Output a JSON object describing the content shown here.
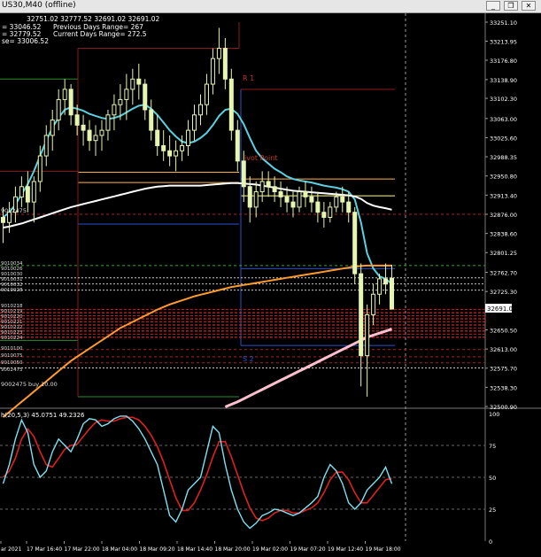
{
  "window": {
    "title": "US30,M40 (offline)",
    "minimize_label": "_",
    "restore_label": "❐",
    "close_label": "✕"
  },
  "info": {
    "ohlc_line": "32751.02 32777.52 32691.02 32691.02",
    "line2": "= 33046.52",
    "line3": "= 32779.52",
    "line4": "se= 33006.52",
    "prev_range": "Previous Days Range= 267",
    "curr_range": "Current Days Range= 272.5"
  },
  "price_axis": {
    "ticks": [
      "33251.10",
      "33213.95",
      "33176.80",
      "33138.90",
      "33102.30",
      "33063.00",
      "33025.60",
      "32988.35",
      "32950.80",
      "32913.40",
      "32876.00",
      "32838.60",
      "32801.25",
      "32762.70",
      "32725.30",
      "32691.02",
      "32650.50",
      "32613.00",
      "32575.70",
      "32538.30",
      "32500.90"
    ],
    "current_price": "32691.02",
    "colors": {
      "current_bg": "#ffffff",
      "text": "#ffffff"
    }
  },
  "stoch_axis": {
    "label": "h(20,5,3) 45.0751 49.2326",
    "ticks": [
      "100",
      "75",
      "50",
      "25",
      "0"
    ]
  },
  "time_axis": {
    "ticks": [
      "ar 2021",
      "17 Mar 16:40",
      "17 Mar 22:00",
      "18 Mar 04:00",
      "18 Mar 09:20",
      "18 Mar 14:40",
      "18 Mar 20:00",
      "19 Mar 02:00",
      "19 Mar 07:20",
      "19 Mar 12:40",
      "19 Mar 18:00"
    ]
  },
  "levels": {
    "r1": "R 1",
    "pivot": "ivot Point",
    "s2": "S 2",
    "buy_order": "9002475 buy 10.00",
    "order_id_left": "9002475"
  },
  "left_tags": [
    "9010034",
    "9010026",
    "9010030",
    "9010031",
    "9010032",
    "9010028",
    "9010218",
    "9010219",
    "9010220",
    "9010221",
    "9010222",
    "9010223",
    "9010224",
    "9010100",
    "9010075",
    "9010050",
    "9002475"
  ],
  "chart_data": {
    "type": "line",
    "y_range": [
      32500.9,
      33251.1
    ],
    "x_labels": [
      "ar 2021",
      "17 Mar 16:40",
      "17 Mar 22:00",
      "18 Mar 04:00",
      "18 Mar 09:20",
      "18 Mar 14:40",
      "18 Mar 20:00",
      "19 Mar 02:00",
      "19 Mar 07:20",
      "19 Mar 12:40",
      "19 Mar 18:00"
    ],
    "candles": [
      [
        32870,
        32890,
        32820,
        32860
      ],
      [
        32860,
        32900,
        32840,
        32880
      ],
      [
        32880,
        32930,
        32860,
        32910
      ],
      [
        32910,
        32950,
        32890,
        32930
      ],
      [
        32930,
        32960,
        32880,
        32900
      ],
      [
        32900,
        32950,
        32860,
        32940
      ],
      [
        32940,
        33010,
        32920,
        32990
      ],
      [
        32990,
        33050,
        32970,
        33030
      ],
      [
        33030,
        33080,
        33000,
        33060
      ],
      [
        33060,
        33120,
        33040,
        33100
      ],
      [
        33100,
        33140,
        33070,
        33120
      ],
      [
        33120,
        33130,
        33050,
        33070
      ],
      [
        33070,
        33090,
        33030,
        33050
      ],
      [
        33050,
        33070,
        33010,
        33040
      ],
      [
        33040,
        33060,
        33000,
        33020
      ],
      [
        33020,
        33050,
        32990,
        33030
      ],
      [
        33030,
        33060,
        33000,
        33040
      ],
      [
        33040,
        33080,
        33020,
        33070
      ],
      [
        33070,
        33110,
        33040,
        33090
      ],
      [
        33090,
        33130,
        33060,
        33100
      ],
      [
        33100,
        33150,
        33060,
        33120
      ],
      [
        33120,
        33160,
        33090,
        33140
      ],
      [
        33140,
        33170,
        33100,
        33130
      ],
      [
        33130,
        33140,
        33060,
        33080
      ],
      [
        33080,
        33100,
        33020,
        33040
      ],
      [
        33040,
        33070,
        32990,
        33010
      ],
      [
        33010,
        33040,
        32980,
        33000
      ],
      [
        33000,
        33030,
        32970,
        32990
      ],
      [
        32990,
        33020,
        32960,
        33000
      ],
      [
        33000,
        33030,
        32980,
        33010
      ],
      [
        33010,
        33060,
        32990,
        33040
      ],
      [
        33040,
        33090,
        33020,
        33070
      ],
      [
        33070,
        33110,
        33050,
        33090
      ],
      [
        33090,
        33150,
        33070,
        33130
      ],
      [
        33130,
        33200,
        33110,
        33180
      ],
      [
        33180,
        33240,
        33150,
        33200
      ],
      [
        33200,
        33220,
        33120,
        33140
      ],
      [
        33140,
        33160,
        33020,
        33040
      ],
      [
        33040,
        33060,
        32960,
        32980
      ],
      [
        32980,
        33000,
        32900,
        32930
      ],
      [
        32930,
        32950,
        32860,
        32890
      ],
      [
        32890,
        32940,
        32870,
        32920
      ],
      [
        32920,
        32960,
        32900,
        32940
      ],
      [
        32940,
        32960,
        32910,
        32930
      ],
      [
        32930,
        32950,
        32900,
        32920
      ],
      [
        32920,
        32940,
        32890,
        32910
      ],
      [
        32910,
        32930,
        32880,
        32900
      ],
      [
        32900,
        32920,
        32870,
        32890
      ],
      [
        32890,
        32930,
        32880,
        32920
      ],
      [
        32920,
        32940,
        32890,
        32910
      ],
      [
        32910,
        32930,
        32880,
        32900
      ],
      [
        32900,
        32920,
        32860,
        32880
      ],
      [
        32880,
        32900,
        32850,
        32870
      ],
      [
        32870,
        32900,
        32860,
        32890
      ],
      [
        32890,
        32920,
        32880,
        32910
      ],
      [
        32910,
        32930,
        32880,
        32900
      ],
      [
        32900,
        32920,
        32860,
        32880
      ],
      [
        32880,
        32890,
        32740,
        32760
      ],
      [
        32760,
        32780,
        32540,
        32600
      ],
      [
        32600,
        32700,
        32520,
        32680
      ],
      [
        32680,
        32740,
        32660,
        32720
      ],
      [
        32720,
        32760,
        32700,
        32750
      ],
      [
        32750,
        32780,
        32720,
        32740
      ],
      [
        32751.02,
        32777.52,
        32691.02,
        32691.02
      ]
    ],
    "series": [
      {
        "color": "#5ad0e0",
        "values": [
          32870,
          32880,
          32895,
          32915,
          32935,
          32960,
          32990,
          33020,
          33045,
          33065,
          33080,
          33085,
          33082,
          33078,
          33072,
          33068,
          33064,
          33062,
          33064,
          33068,
          33075,
          33082,
          33088,
          33090,
          33082,
          33070,
          33055,
          33040,
          33028,
          33018,
          33015,
          33018,
          33025,
          33035,
          33050,
          33068,
          33080,
          33082,
          33072,
          33052,
          33025,
          33000,
          32985,
          32975,
          32965,
          32958,
          32950,
          32945,
          32942,
          32940,
          32938,
          32935,
          32932,
          32930,
          32928,
          32925,
          32920,
          32905,
          32860,
          32800,
          32770,
          32755,
          32750,
          32740
        ]
      },
      {
        "color": "#ffffff",
        "values": [
          32850,
          32852,
          32855,
          32858,
          32862,
          32866,
          32870,
          32874,
          32878,
          32882,
          32886,
          32890,
          32893,
          32896,
          32899,
          32902,
          32905,
          32908,
          32911,
          32914,
          32917,
          32920,
          32923,
          32926,
          32928,
          32930,
          32931,
          32932,
          32932,
          32932,
          32932,
          32932,
          32932,
          32933,
          32934,
          32935,
          32936,
          32937,
          32937,
          32936,
          32935,
          32934,
          32932,
          32930,
          32928,
          32926,
          32924,
          32922,
          32921,
          32920,
          32919,
          32918,
          32917,
          32916,
          32915,
          32914,
          32913,
          32911,
          32906,
          32898,
          32893,
          32890,
          32888,
          32885
        ]
      },
      {
        "color": "#ff9a2e",
        "values": [
          32480,
          32490,
          32500,
          32510,
          32520,
          32530,
          32540,
          32550,
          32560,
          32570,
          32580,
          32590,
          32598,
          32606,
          32614,
          32622,
          32630,
          32638,
          32646,
          32654,
          32660,
          32666,
          32672,
          32678,
          32684,
          32690,
          32695,
          32700,
          32704,
          32708,
          32712,
          32716,
          32719,
          32722,
          32725,
          32728,
          32731,
          32734,
          32736,
          32738,
          32740,
          32742,
          32744,
          32746,
          32748,
          32750,
          32752,
          32754,
          32756,
          32758,
          32760,
          32762,
          32764,
          32766,
          32768,
          32770,
          32772,
          32774,
          32775,
          32776,
          32776,
          32776,
          32776,
          32776
        ]
      },
      {
        "color": "#ffc0d0",
        "values": [
          null,
          null,
          null,
          null,
          null,
          null,
          null,
          null,
          null,
          null,
          null,
          null,
          null,
          null,
          null,
          null,
          null,
          null,
          null,
          null,
          null,
          null,
          null,
          null,
          null,
          null,
          null,
          null,
          null,
          null,
          null,
          null,
          null,
          null,
          null,
          null,
          32500,
          32505,
          32510,
          32516,
          32522,
          32528,
          32534,
          32540,
          32546,
          32552,
          32558,
          32564,
          32570,
          32576,
          32582,
          32588,
          32594,
          32600,
          32606,
          32612,
          32618,
          32624,
          32630,
          32636,
          32640,
          32644,
          32648,
          32652
        ]
      }
    ],
    "stochastic": {
      "y_range": [
        0,
        100
      ],
      "main": [
        45,
        60,
        80,
        95,
        85,
        60,
        50,
        55,
        70,
        80,
        75,
        70,
        80,
        92,
        96,
        95,
        90,
        92,
        96,
        98,
        98,
        94,
        88,
        80,
        70,
        60,
        40,
        20,
        15,
        25,
        40,
        45,
        50,
        70,
        90,
        85,
        60,
        40,
        25,
        15,
        10,
        14,
        20,
        22,
        25,
        24,
        22,
        20,
        22,
        26,
        30,
        35,
        50,
        60,
        55,
        45,
        30,
        25,
        30,
        40,
        45,
        50,
        58,
        45
      ],
      "signal": [
        50,
        55,
        65,
        80,
        88,
        82,
        70,
        60,
        58,
        65,
        72,
        75,
        76,
        82,
        88,
        93,
        95,
        94,
        94,
        96,
        97,
        97,
        95,
        90,
        83,
        74,
        62,
        48,
        34,
        24,
        24,
        30,
        40,
        52,
        66,
        78,
        78,
        66,
        52,
        38,
        26,
        18,
        16,
        18,
        22,
        24,
        24,
        22,
        22,
        24,
        26,
        30,
        38,
        48,
        54,
        54,
        48,
        38,
        30,
        30,
        36,
        42,
        48,
        49.2
      ]
    }
  }
}
